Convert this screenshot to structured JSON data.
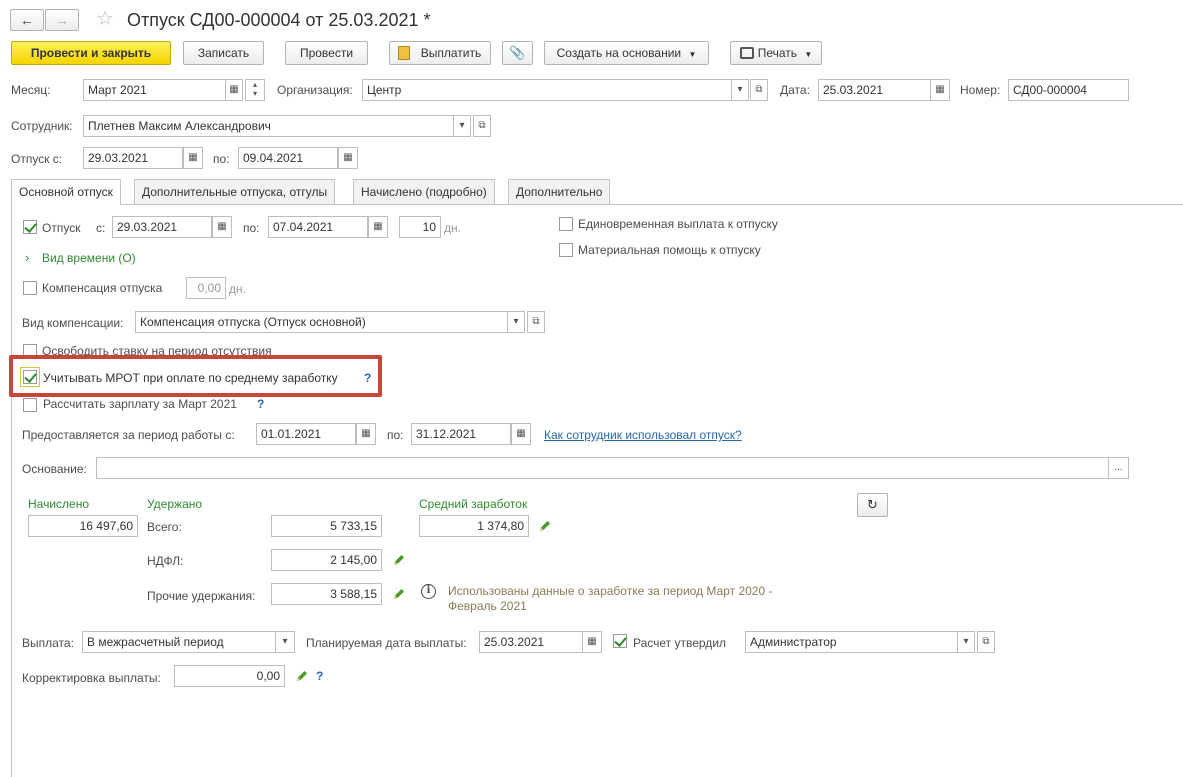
{
  "title": "Отпуск СД00-000004 от 25.03.2021 *",
  "toolbar": {
    "post_close": "Провести и закрыть",
    "save": "Записать",
    "post": "Провести",
    "pay": "Выплатить",
    "create_based": "Создать на основании",
    "print": "Печать"
  },
  "header": {
    "month_label": "Месяц:",
    "month_value": "Март 2021",
    "org_label": "Организация:",
    "org_value": "Центр",
    "date_label": "Дата:",
    "date_value": "25.03.2021",
    "number_label": "Номер:",
    "number_value": "СД00-000004",
    "employee_label": "Сотрудник:",
    "employee_value": "Плетнев Максим Александрович",
    "vac_from_label": "Отпуск с:",
    "vac_from_value": "29.03.2021",
    "vac_to_label": "по:",
    "vac_to_value": "09.04.2021"
  },
  "tabs": [
    {
      "label": "Основной отпуск"
    },
    {
      "label": "Дополнительные отпуска, отгулы"
    },
    {
      "label": "Начислено (подробно)"
    },
    {
      "label": "Дополнительно"
    }
  ],
  "main": {
    "vacation_label": "Отпуск",
    "from_label": "с:",
    "from_value": "29.03.2021",
    "to_label": "по:",
    "to_value": "07.04.2021",
    "days_value": "10",
    "days_unit": "дн.",
    "lump_sum_label": "Единовременная выплата к отпуску",
    "material_aid_label": "Материальная помощь к отпуску",
    "time_type_link": "Вид времени (О)",
    "compensation_label": "Компенсация отпуска",
    "compensation_value": "0,00",
    "compensation_unit": "дн.",
    "comp_type_label": "Вид компенсации:",
    "comp_type_value": "Компенсация отпуска (Отпуск основной)",
    "release_rate_label": "Освободить ставку на период отсутствия",
    "mrot_label": "Учитывать МРОТ при оплате по среднему заработку",
    "mrot_help": "?",
    "calc_salary_label": "Рассчитать зарплату за Март 2021",
    "calc_salary_help": "?",
    "period_label": "Предоставляется за период работы с:",
    "period_from": "01.01.2021",
    "period_to_label": "по:",
    "period_to": "31.12.2021",
    "usage_link": "Как сотрудник использовал отпуск?",
    "basis_label": "Основание:",
    "basis_value": "",
    "basis_btn": "...",
    "accrued_label": "Начислено",
    "accrued_value": "16 497,60",
    "withheld_label": "Удержано",
    "total_label": "Всего:",
    "total_value": "5 733,15",
    "ndfl_label": "НДФЛ:",
    "ndfl_value": "2 145,00",
    "other_label": "Прочие удержания:",
    "other_value": "3 588,15",
    "avg_label": "Средний заработок",
    "avg_value": "1 374,80",
    "info_text_1": "Использованы данные о заработке за период Март 2020 -",
    "info_text_2": "Февраль 2021",
    "payment_label": "Выплата:",
    "payment_value": "В межрасчетный период",
    "planned_date_label": "Планируемая дата выплаты:",
    "planned_date_value": "25.03.2021",
    "approved_label": "Расчет утвердил",
    "approved_value": "Администратор",
    "correction_label": "Корректировка выплаты:",
    "correction_value": "0,00",
    "correction_help": "?"
  },
  "colors": {
    "accent_green": "#2e8b2e",
    "highlight_red": "#c8453a",
    "primary_yellow": "#f5d400",
    "link_blue": "#2466b3"
  }
}
